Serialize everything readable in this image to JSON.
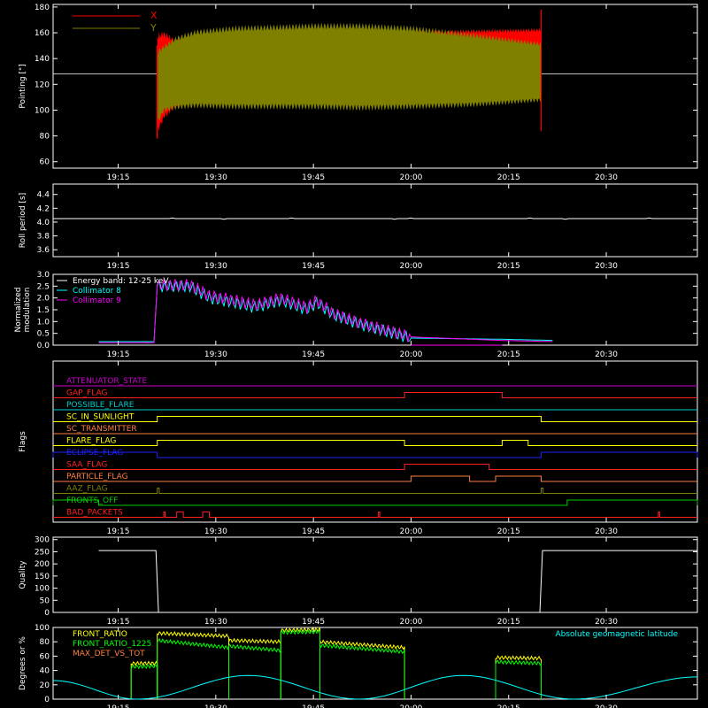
{
  "chart_data": [
    {
      "type": "line",
      "ylabel": "Pointing [\"]",
      "ylim": [
        55,
        182
      ],
      "yticks": [
        60,
        80,
        100,
        120,
        140,
        160,
        180
      ],
      "xlim": [
        "19:05",
        "20:44"
      ],
      "xticks": [
        "19:15",
        "19:30",
        "19:45",
        "20:00",
        "20:15",
        "20:30"
      ],
      "series": [
        {
          "name": "X",
          "color": "#ff0000",
          "envelope": {
            "t": [
              "19:21",
              "19:22",
              "19:24",
              "19:27",
              "19:33",
              "19:40",
              "19:45",
              "19:52",
              "20:00",
              "20:10",
              "20:20"
            ],
            "upper": [
              160,
              162,
              155,
              153,
              154,
              155,
              158,
              160,
              162,
              163,
              164
            ],
            "lower": [
              80,
              92,
              102,
              108,
              112,
              114,
              115,
              116,
              116,
              117,
              117
            ]
          }
        },
        {
          "name": "Y",
          "color": "#808000",
          "envelope": {
            "t": [
              "19:21",
              "19:22",
              "19:24",
              "19:27",
              "19:33",
              "19:40",
              "19:45",
              "19:52",
              "20:00",
              "20:10",
              "20:20"
            ],
            "upper": [
              147,
              151,
              158,
              163,
              166,
              167,
              168,
              168,
              166,
              160,
              153
            ],
            "lower": [
              88,
              98,
              100,
              101,
              100,
              100,
              100,
              99,
              100,
              102,
              106
            ]
          }
        }
      ],
      "reference_line": 128,
      "data_window": [
        "19:21",
        "20:20"
      ]
    },
    {
      "type": "line",
      "ylabel": "Roll period [s]",
      "ylim": [
        3.5,
        4.55
      ],
      "yticks": [
        3.6,
        3.8,
        4.0,
        4.2,
        4.4
      ],
      "xticks": [
        "19:15",
        "19:30",
        "19:45",
        "20:00",
        "20:15",
        "20:30"
      ],
      "series": [
        {
          "color": "#ffffff",
          "constant": 4.05
        }
      ]
    },
    {
      "type": "line",
      "ylabel_lines": [
        "Normalized",
        "modulation"
      ],
      "ylim": [
        0,
        3.0
      ],
      "yticks": [
        0.0,
        0.5,
        1.0,
        1.5,
        2.0,
        2.5,
        3.0
      ],
      "xticks": [
        "19:15",
        "19:30",
        "19:45",
        "20:00",
        "20:15",
        "20:30"
      ],
      "legend": [
        {
          "label": "Energy band: 12-25 keV",
          "color": "#ffffff"
        },
        {
          "label": "Collimator 8",
          "color": "#00ffff"
        },
        {
          "label": "Collimator 9",
          "color": "#ff00ff"
        }
      ],
      "series": [
        {
          "name": "Collimator 8",
          "color": "#00ffff",
          "t": [
            "19:12",
            "19:20.5",
            "19:21",
            "19:26",
            "19:29",
            "19:33",
            "19:36",
            "19:40",
            "19:44",
            "19:45.5",
            "19:48",
            "19:52",
            "20:00",
            "20:14",
            "20:22"
          ],
          "v": [
            0.15,
            0.15,
            2.5,
            2.5,
            2.0,
            1.8,
            1.6,
            1.9,
            1.5,
            1.8,
            1.3,
            0.9,
            0.3,
            0.25,
            0.2
          ]
        },
        {
          "name": "Collimator 9",
          "color": "#ff00ff",
          "t": [
            "19:12",
            "19:20.5",
            "19:21",
            "19:26",
            "19:29",
            "19:33",
            "19:36",
            "19:40",
            "19:44",
            "19:45.5",
            "19:48",
            "19:52",
            "20:00",
            "20:14",
            "20:22"
          ],
          "v": [
            0.1,
            0.1,
            2.55,
            2.55,
            2.1,
            1.9,
            1.7,
            2.0,
            1.6,
            1.9,
            1.35,
            0.95,
            0.35,
            0.2,
            0.15
          ]
        }
      ]
    },
    {
      "type": "table",
      "ylabel": "Flags",
      "xticks": [
        "19:15",
        "19:30",
        "19:45",
        "20:00",
        "20:15",
        "20:30"
      ],
      "flags": [
        {
          "name": "ATTENUATOR_STATE",
          "color": "#cc00cc",
          "on": []
        },
        {
          "name": "GAP_FLAG",
          "color": "#ff2020",
          "on": [
            [
              "19:59",
              "20:14"
            ]
          ]
        },
        {
          "name": "POSSIBLE_FLARE",
          "color": "#00cccc",
          "on": []
        },
        {
          "name": "SC_IN_SUNLIGHT",
          "color": "#ffff00",
          "on": [
            [
              "19:21",
              "20:20"
            ]
          ]
        },
        {
          "name": "SC_TRANSMITTER",
          "color": "#ff8040",
          "on": []
        },
        {
          "name": "FLARE_FLAG",
          "color": "#ffff00",
          "on": [
            [
              "19:21",
              "19:59"
            ],
            [
              "20:14",
              "20:18"
            ]
          ]
        },
        {
          "name": "ECLIPSE_FLAG",
          "color": "#2020ff",
          "on": [
            [
              "19:05",
              "19:21"
            ],
            [
              "20:20",
              "20:44"
            ]
          ]
        },
        {
          "name": "SAA_FLAG",
          "color": "#ff2020",
          "on": [
            [
              "19:59",
              "20:12"
            ]
          ]
        },
        {
          "name": "PARTICLE_FLAG",
          "color": "#ff8040",
          "on": [
            [
              "20:00",
              "20:09"
            ],
            [
              "20:13",
              "20:20"
            ]
          ]
        },
        {
          "name": "AAZ_FLAG",
          "color": "#808000",
          "on": [
            [
              "19:21",
              "19:21.3"
            ],
            [
              "20:20",
              "20:20.3"
            ]
          ]
        },
        {
          "name": "FRONTS_OFF",
          "color": "#00cc00",
          "on": [
            [
              "19:05",
              "19:12"
            ],
            [
              "20:24",
              "20:44"
            ]
          ]
        },
        {
          "name": "BAD_PACKETS",
          "color": "#ff2020",
          "on": [
            [
              "19:22",
              "19:22.2"
            ],
            [
              "19:24",
              "19:25"
            ],
            [
              "19:28",
              "19:29"
            ],
            [
              "19:55",
              "19:55.2"
            ],
            [
              "20:38",
              "20:38.2"
            ]
          ]
        }
      ]
    },
    {
      "type": "line",
      "ylabel": "Quality",
      "ylim": [
        0,
        310
      ],
      "yticks": [
        0,
        50,
        100,
        150,
        200,
        250,
        300
      ],
      "xticks": [
        "19:15",
        "19:30",
        "19:45",
        "20:00",
        "20:15",
        "20:30"
      ],
      "series": [
        {
          "color": "#ffffff",
          "t": [
            "19:12",
            "19:20.8",
            "19:21.2",
            "20:19.8",
            "20:20.2",
            "20:44"
          ],
          "v": [
            255,
            255,
            0,
            0,
            255,
            255
          ]
        }
      ]
    },
    {
      "type": "line",
      "ylabel": "Degrees or %",
      "ylim": [
        0,
        100
      ],
      "yticks": [
        0,
        20,
        40,
        60,
        80,
        100
      ],
      "xticks": [
        "19:15",
        "19:30",
        "19:45",
        "20:00",
        "20:15",
        "20:30"
      ],
      "legend": [
        {
          "label": "FRONT_RATIO",
          "color": "#ffff00"
        },
        {
          "label": "FRONT_RATIO_1225",
          "color": "#00ff00"
        },
        {
          "label": "MAX_DET_VS_TOT",
          "color": "#ff8040"
        }
      ],
      "right_legend": {
        "label": "Absolute geomagnetic latitude",
        "color": "#00ffff"
      },
      "series": [
        {
          "name": "FRONT_RATIO",
          "color": "#ffff00",
          "segments": [
            {
              "t": [
                "19:17",
                "19:21"
              ],
              "v": [
                50,
                50
              ]
            },
            {
              "t": [
                "19:21",
                "19:32"
              ],
              "v": [
                92,
                88
              ]
            },
            {
              "t": [
                "19:32",
                "19:40"
              ],
              "v": [
                82,
                80
              ]
            },
            {
              "t": [
                "19:40",
                "19:46"
              ],
              "v": [
                96,
                97
              ]
            },
            {
              "t": [
                "19:46",
                "19:59"
              ],
              "v": [
                80,
                72
              ]
            },
            {
              "t": [
                "20:13",
                "20:20"
              ],
              "v": [
                58,
                57
              ]
            }
          ]
        },
        {
          "name": "FRONT_RATIO_1225",
          "color": "#00ff00",
          "segments": [
            {
              "t": [
                "19:17",
                "19:21"
              ],
              "v": [
                45,
                46
              ]
            },
            {
              "t": [
                "19:21",
                "19:32"
              ],
              "v": [
                82,
                72
              ]
            },
            {
              "t": [
                "19:32",
                "19:40"
              ],
              "v": [
                74,
                68
              ]
            },
            {
              "t": [
                "19:40",
                "19:46"
              ],
              "v": [
                93,
                94
              ]
            },
            {
              "t": [
                "19:46",
                "19:59"
              ],
              "v": [
                75,
                66
              ]
            },
            {
              "t": [
                "20:13",
                "20:20"
              ],
              "v": [
                52,
                50
              ]
            }
          ]
        },
        {
          "name": "MAX_DET_VS_TOT",
          "color": "#ff8040",
          "segments": []
        },
        {
          "name": "Absolute geomagnetic latitude",
          "color": "#00ffff",
          "t": [
            "19:05",
            "19:18",
            "19:35",
            "19:52",
            "20:08",
            "20:25",
            "20:44"
          ],
          "v": [
            26,
            0,
            33,
            0,
            33,
            0,
            31
          ]
        }
      ]
    }
  ]
}
